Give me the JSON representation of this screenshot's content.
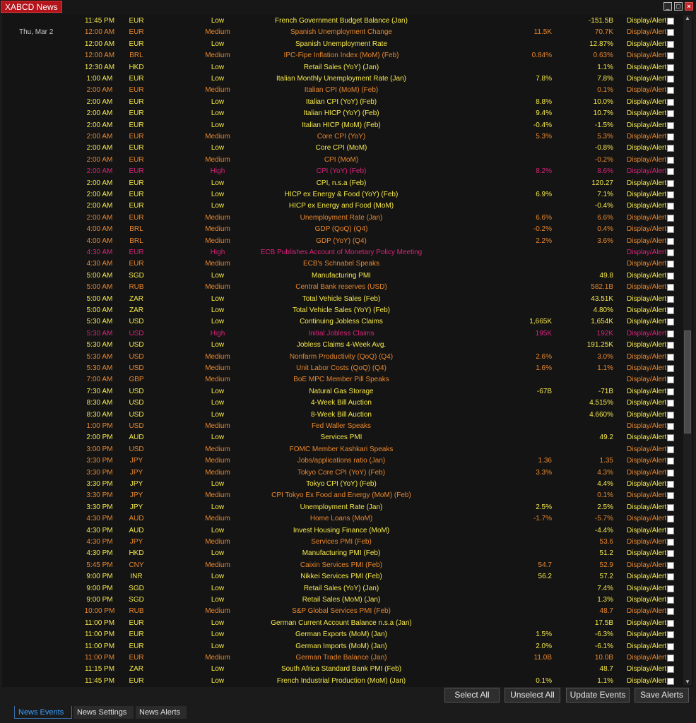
{
  "window": {
    "title": "XABCD News",
    "minimize": "_",
    "maximize": "□",
    "close": "×"
  },
  "colors": {
    "low": "#f5e84a",
    "medium": "#e8872d",
    "high": "#d8247a",
    "tab_active": "#3aa0ff",
    "title_bg": "#b3131b"
  },
  "rows": [
    {
      "date": "",
      "time": "11:45 PM",
      "currency": "EUR",
      "importance": "Low",
      "event": "French Government Budget Balance (Jan)",
      "forecast": "",
      "previous": "-151.5B",
      "action": "Display/Alert"
    },
    {
      "date": "Thu, Mar 2",
      "time": "12:00 AM",
      "currency": "EUR",
      "importance": "Medium",
      "event": "Spanish Unemployment Change",
      "forecast": "11.5K",
      "previous": "70.7K",
      "action": "Display/Alert"
    },
    {
      "date": "",
      "time": "12:00 AM",
      "currency": "EUR",
      "importance": "Low",
      "event": "Spanish Unemployment Rate",
      "forecast": "",
      "previous": "12.87%",
      "action": "Display/Alert"
    },
    {
      "date": "",
      "time": "12:00 AM",
      "currency": "BRL",
      "importance": "Medium",
      "event": "IPC-Fipe Inflation Index (MoM) (Feb)",
      "forecast": "0.84%",
      "previous": "0.63%",
      "action": "Display/Alert"
    },
    {
      "date": "",
      "time": "12:30 AM",
      "currency": "HKD",
      "importance": "Low",
      "event": "Retail Sales (YoY) (Jan)",
      "forecast": "",
      "previous": "1.1%",
      "action": "Display/Alert"
    },
    {
      "date": "",
      "time": "1:00 AM",
      "currency": "EUR",
      "importance": "Low",
      "event": "Italian Monthly Unemployment Rate (Jan)",
      "forecast": "7.8%",
      "previous": "7.8%",
      "action": "Display/Alert"
    },
    {
      "date": "",
      "time": "2:00 AM",
      "currency": "EUR",
      "importance": "Medium",
      "event": "Italian CPI (MoM) (Feb)",
      "forecast": "",
      "previous": "0.1%",
      "action": "Display/Alert"
    },
    {
      "date": "",
      "time": "2:00 AM",
      "currency": "EUR",
      "importance": "Low",
      "event": "Italian CPI (YoY) (Feb)",
      "forecast": "8.8%",
      "previous": "10.0%",
      "action": "Display/Alert"
    },
    {
      "date": "",
      "time": "2:00 AM",
      "currency": "EUR",
      "importance": "Low",
      "event": "Italian HICP (YoY) (Feb)",
      "forecast": "9.4%",
      "previous": "10.7%",
      "action": "Display/Alert"
    },
    {
      "date": "",
      "time": "2:00 AM",
      "currency": "EUR",
      "importance": "Low",
      "event": "Italian HICP (MoM) (Feb)",
      "forecast": "-0.4%",
      "previous": "-1.5%",
      "action": "Display/Alert"
    },
    {
      "date": "",
      "time": "2:00 AM",
      "currency": "EUR",
      "importance": "Medium",
      "event": "Core CPI (YoY)",
      "forecast": "5.3%",
      "previous": "5.3%",
      "action": "Display/Alert"
    },
    {
      "date": "",
      "time": "2:00 AM",
      "currency": "EUR",
      "importance": "Low",
      "event": "Core CPI (MoM)",
      "forecast": "",
      "previous": "-0.8%",
      "action": "Display/Alert"
    },
    {
      "date": "",
      "time": "2:00 AM",
      "currency": "EUR",
      "importance": "Medium",
      "event": "CPI (MoM)",
      "forecast": "",
      "previous": "-0.2%",
      "action": "Display/Alert"
    },
    {
      "date": "",
      "time": "2:00 AM",
      "currency": "EUR",
      "importance": "High",
      "event": "CPI (YoY) (Feb)",
      "forecast": "8.2%",
      "previous": "8.6%",
      "action": "Display/Alert"
    },
    {
      "date": "",
      "time": "2:00 AM",
      "currency": "EUR",
      "importance": "Low",
      "event": "CPI, n.s.a (Feb)",
      "forecast": "",
      "previous": "120.27",
      "action": "Display/Alert"
    },
    {
      "date": "",
      "time": "2:00 AM",
      "currency": "EUR",
      "importance": "Low",
      "event": "HICP ex Energy & Food (YoY) (Feb)",
      "forecast": "6.9%",
      "previous": "7.1%",
      "action": "Display/Alert"
    },
    {
      "date": "",
      "time": "2:00 AM",
      "currency": "EUR",
      "importance": "Low",
      "event": "HICP ex Energy and Food (MoM)",
      "forecast": "",
      "previous": "-0.4%",
      "action": "Display/Alert"
    },
    {
      "date": "",
      "time": "2:00 AM",
      "currency": "EUR",
      "importance": "Medium",
      "event": "Unemployment Rate (Jan)",
      "forecast": "6.6%",
      "previous": "6.6%",
      "action": "Display/Alert"
    },
    {
      "date": "",
      "time": "4:00 AM",
      "currency": "BRL",
      "importance": "Medium",
      "event": "GDP (QoQ) (Q4)",
      "forecast": "-0.2%",
      "previous": "0.4%",
      "action": "Display/Alert"
    },
    {
      "date": "",
      "time": "4:00 AM",
      "currency": "BRL",
      "importance": "Medium",
      "event": "GDP (YoY) (Q4)",
      "forecast": "2.2%",
      "previous": "3.6%",
      "action": "Display/Alert"
    },
    {
      "date": "",
      "time": "4:30 AM",
      "currency": "EUR",
      "importance": "High",
      "event": "ECB Publishes Account of Monetary Policy Meeting",
      "forecast": "",
      "previous": "",
      "action": "Display/Alert"
    },
    {
      "date": "",
      "time": "4:30 AM",
      "currency": "EUR",
      "importance": "Medium",
      "event": "ECB's Schnabel Speaks",
      "forecast": "",
      "previous": "",
      "action": "Display/Alert"
    },
    {
      "date": "",
      "time": "5:00 AM",
      "currency": "SGD",
      "importance": "Low",
      "event": "Manufacturing PMI",
      "forecast": "",
      "previous": "49.8",
      "action": "Display/Alert"
    },
    {
      "date": "",
      "time": "5:00 AM",
      "currency": "RUB",
      "importance": "Medium",
      "event": "Central Bank reserves (USD)",
      "forecast": "",
      "previous": "582.1B",
      "action": "Display/Alert"
    },
    {
      "date": "",
      "time": "5:00 AM",
      "currency": "ZAR",
      "importance": "Low",
      "event": "Total Vehicle Sales (Feb)",
      "forecast": "",
      "previous": "43.51K",
      "action": "Display/Alert"
    },
    {
      "date": "",
      "time": "5:00 AM",
      "currency": "ZAR",
      "importance": "Low",
      "event": "Total Vehicle Sales (YoY) (Feb)",
      "forecast": "",
      "previous": "4.80%",
      "action": "Display/Alert"
    },
    {
      "date": "",
      "time": "5:30 AM",
      "currency": "USD",
      "importance": "Low",
      "event": "Continuing Jobless Claims",
      "forecast": "1,665K",
      "previous": "1,654K",
      "action": "Display/Alert"
    },
    {
      "date": "",
      "time": "5:30 AM",
      "currency": "USD",
      "importance": "High",
      "event": "Initial Jobless Claims",
      "forecast": "195K",
      "previous": "192K",
      "action": "Display/Alert"
    },
    {
      "date": "",
      "time": "5:30 AM",
      "currency": "USD",
      "importance": "Low",
      "event": "Jobless Claims 4-Week Avg.",
      "forecast": "",
      "previous": "191.25K",
      "action": "Display/Alert"
    },
    {
      "date": "",
      "time": "5:30 AM",
      "currency": "USD",
      "importance": "Medium",
      "event": "Nonfarm Productivity (QoQ) (Q4)",
      "forecast": "2.6%",
      "previous": "3.0%",
      "action": "Display/Alert"
    },
    {
      "date": "",
      "time": "5:30 AM",
      "currency": "USD",
      "importance": "Medium",
      "event": "Unit Labor Costs (QoQ) (Q4)",
      "forecast": "1.6%",
      "previous": "1.1%",
      "action": "Display/Alert"
    },
    {
      "date": "",
      "time": "7:00 AM",
      "currency": "GBP",
      "importance": "Medium",
      "event": "BoE MPC Member Pill Speaks",
      "forecast": "",
      "previous": "",
      "action": "Display/Alert"
    },
    {
      "date": "",
      "time": "7:30 AM",
      "currency": "USD",
      "importance": "Low",
      "event": "Natural Gas Storage",
      "forecast": "-67B",
      "previous": "-71B",
      "action": "Display/Alert"
    },
    {
      "date": "",
      "time": "8:30 AM",
      "currency": "USD",
      "importance": "Low",
      "event": "4-Week Bill Auction",
      "forecast": "",
      "previous": "4.515%",
      "action": "Display/Alert"
    },
    {
      "date": "",
      "time": "8:30 AM",
      "currency": "USD",
      "importance": "Low",
      "event": "8-Week Bill Auction",
      "forecast": "",
      "previous": "4.660%",
      "action": "Display/Alert"
    },
    {
      "date": "",
      "time": "1:00 PM",
      "currency": "USD",
      "importance": "Medium",
      "event": "Fed Waller Speaks",
      "forecast": "",
      "previous": "",
      "action": "Display/Alert"
    },
    {
      "date": "",
      "time": "2:00 PM",
      "currency": "AUD",
      "importance": "Low",
      "event": "Services PMI",
      "forecast": "",
      "previous": "49.2",
      "action": "Display/Alert"
    },
    {
      "date": "",
      "time": "3:00 PM",
      "currency": "USD",
      "importance": "Medium",
      "event": "FOMC Member Kashkari Speaks",
      "forecast": "",
      "previous": "",
      "action": "Display/Alert"
    },
    {
      "date": "",
      "time": "3:30 PM",
      "currency": "JPY",
      "importance": "Medium",
      "event": "Jobs/applications ratio (Jan)",
      "forecast": "1.36",
      "previous": "1.35",
      "action": "Display/Alert"
    },
    {
      "date": "",
      "time": "3:30 PM",
      "currency": "JPY",
      "importance": "Medium",
      "event": "Tokyo Core CPI (YoY) (Feb)",
      "forecast": "3.3%",
      "previous": "4.3%",
      "action": "Display/Alert"
    },
    {
      "date": "",
      "time": "3:30 PM",
      "currency": "JPY",
      "importance": "Low",
      "event": "Tokyo CPI (YoY) (Feb)",
      "forecast": "",
      "previous": "4.4%",
      "action": "Display/Alert"
    },
    {
      "date": "",
      "time": "3:30 PM",
      "currency": "JPY",
      "importance": "Medium",
      "event": "CPI Tokyo Ex Food and Energy (MoM) (Feb)",
      "forecast": "",
      "previous": "0.1%",
      "action": "Display/Alert"
    },
    {
      "date": "",
      "time": "3:30 PM",
      "currency": "JPY",
      "importance": "Low",
      "event": "Unemployment Rate (Jan)",
      "forecast": "2.5%",
      "previous": "2.5%",
      "action": "Display/Alert"
    },
    {
      "date": "",
      "time": "4:30 PM",
      "currency": "AUD",
      "importance": "Medium",
      "event": "Home Loans (MoM)",
      "forecast": "-1.7%",
      "previous": "-5.7%",
      "action": "Display/Alert"
    },
    {
      "date": "",
      "time": "4:30 PM",
      "currency": "AUD",
      "importance": "Low",
      "event": "Invest Housing Finance (MoM)",
      "forecast": "",
      "previous": "-4.4%",
      "action": "Display/Alert"
    },
    {
      "date": "",
      "time": "4:30 PM",
      "currency": "JPY",
      "importance": "Medium",
      "event": "Services PMI (Feb)",
      "forecast": "",
      "previous": "53.6",
      "action": "Display/Alert"
    },
    {
      "date": "",
      "time": "4:30 PM",
      "currency": "HKD",
      "importance": "Low",
      "event": "Manufacturing PMI (Feb)",
      "forecast": "",
      "previous": "51.2",
      "action": "Display/Alert"
    },
    {
      "date": "",
      "time": "5:45 PM",
      "currency": "CNY",
      "importance": "Medium",
      "event": "Caixin Services PMI (Feb)",
      "forecast": "54.7",
      "previous": "52.9",
      "action": "Display/Alert"
    },
    {
      "date": "",
      "time": "9:00 PM",
      "currency": "INR",
      "importance": "Low",
      "event": "Nikkei Services PMI (Feb)",
      "forecast": "56.2",
      "previous": "57.2",
      "action": "Display/Alert"
    },
    {
      "date": "",
      "time": "9:00 PM",
      "currency": "SGD",
      "importance": "Low",
      "event": "Retail Sales (YoY) (Jan)",
      "forecast": "",
      "previous": "7.4%",
      "action": "Display/Alert"
    },
    {
      "date": "",
      "time": "9:00 PM",
      "currency": "SGD",
      "importance": "Low",
      "event": "Retail Sales (MoM) (Jan)",
      "forecast": "",
      "previous": "1.3%",
      "action": "Display/Alert"
    },
    {
      "date": "",
      "time": "10:00 PM",
      "currency": "RUB",
      "importance": "Medium",
      "event": "S&P Global Services PMI (Feb)",
      "forecast": "",
      "previous": "48.7",
      "action": "Display/Alert"
    },
    {
      "date": "",
      "time": "11:00 PM",
      "currency": "EUR",
      "importance": "Low",
      "event": "German Current Account Balance n.s.a (Jan)",
      "forecast": "",
      "previous": "17.5B",
      "action": "Display/Alert"
    },
    {
      "date": "",
      "time": "11:00 PM",
      "currency": "EUR",
      "importance": "Low",
      "event": "German Exports (MoM) (Jan)",
      "forecast": "1.5%",
      "previous": "-6.3%",
      "action": "Display/Alert"
    },
    {
      "date": "",
      "time": "11:00 PM",
      "currency": "EUR",
      "importance": "Low",
      "event": "German Imports (MoM) (Jan)",
      "forecast": "2.0%",
      "previous": "-6.1%",
      "action": "Display/Alert"
    },
    {
      "date": "",
      "time": "11:00 PM",
      "currency": "EUR",
      "importance": "Medium",
      "event": "German Trade Balance (Jan)",
      "forecast": "11.0B",
      "previous": "10.0B",
      "action": "Display/Alert"
    },
    {
      "date": "",
      "time": "11:15 PM",
      "currency": "ZAR",
      "importance": "Low",
      "event": "South Africa Standard Bank PMI (Feb)",
      "forecast": "",
      "previous": "48.7",
      "action": "Display/Alert"
    },
    {
      "date": "",
      "time": "11:45 PM",
      "currency": "EUR",
      "importance": "Low",
      "event": "French Industrial Production (MoM) (Jan)",
      "forecast": "0.1%",
      "previous": "1.1%",
      "action": "Display/Alert"
    }
  ],
  "buttons": {
    "select_all": "Select All",
    "unselect_all": "Unselect All",
    "update_events": "Update Events",
    "save_alerts": "Save Alerts"
  },
  "tabs": [
    {
      "label": "News Events",
      "active": true
    },
    {
      "label": "News Settings",
      "active": false
    },
    {
      "label": "News Alerts",
      "active": false
    }
  ],
  "scroll": {
    "up_arrow": "▲",
    "down_arrow": "▼"
  }
}
